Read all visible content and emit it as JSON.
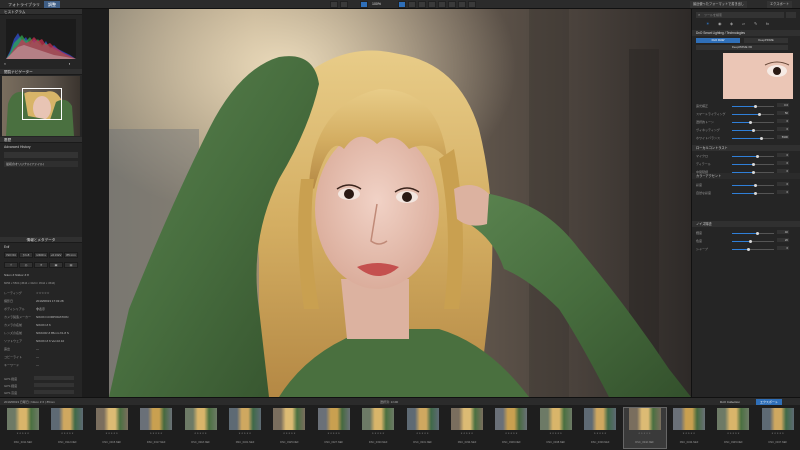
{
  "topbar": {
    "tabs": [
      {
        "label": "フォトライブラリ",
        "active": false
      },
      {
        "label": "調整",
        "active": true
      }
    ],
    "zoom": "100%",
    "right_buttons": [
      "最近使ったフォーマットで書き出し",
      "エクスポート"
    ]
  },
  "left": {
    "histogram_title": "ヒストグラム",
    "navigator_title": "閲覧ナビゲーター",
    "history_title": "履歴",
    "history_item": "Advanced History",
    "history_entry": "最初のオリジナル(ファイル)",
    "info_title": "情報とメタデータ",
    "exif_label": "Exif",
    "exif_values": [
      "ISO 64",
      "ƒ/1.8",
      "1/400 s",
      "+0.3 EV",
      "85 mm"
    ],
    "camera": "Nikon Z Nikkor Z 8",
    "file_dims": "8256 x 5504 (4544 x 3424 / 4544 x 4544)",
    "rows": [
      {
        "label": "レーティング",
        "value": "☆☆☆☆☆"
      },
      {
        "label": "撮影日",
        "value": "2019/08/23 17:03:28"
      },
      {
        "label": "ボディシリアル",
        "value": "非表示"
      },
      {
        "label": "カメラ製造メーカー",
        "value": "NIKON CORPORATION"
      },
      {
        "label": "カメラの名前",
        "value": "NIKON Z 6"
      },
      {
        "label": "レンズの名前",
        "value": "NIKKOR Z 85mm f/1.8 S"
      },
      {
        "label": "ソフトウェア",
        "value": "NIKON Z 6 Ver.02.10"
      },
      {
        "label": "露出",
        "value": "—"
      },
      {
        "label": "コピーライト",
        "value": "—"
      },
      {
        "label": "キーワード",
        "value": "—"
      }
    ],
    "gps_rows": [
      "GPS 緯度",
      "GPS 経度",
      "GPS 高度"
    ]
  },
  "right": {
    "search_placeholder": "ツールを検索",
    "module_title": "DxO Smart Lighting / Technologies",
    "mode_buttons": [
      "DxO RAW",
      "DeepPRIME",
      "DeepPRIME XD"
    ],
    "sliders_a": [
      {
        "label": "露光補正",
        "value": 0.55,
        "num": "0.0"
      },
      {
        "label": "スマートライティング",
        "value": 0.65,
        "num": "50"
      },
      {
        "label": "選択的トーン",
        "value": 0.45,
        "num": "0"
      },
      {
        "label": "ヴィネッティング",
        "value": 0.5,
        "num": "0"
      },
      {
        "label": "ホワイトバランス",
        "value": 0.7,
        "num": "5900"
      }
    ],
    "section_b": "ローカルコントラスト",
    "sliders_b": [
      {
        "label": "マイクロ",
        "value": 0.6,
        "num": "0"
      },
      {
        "label": "ディテール",
        "value": 0.5,
        "num": "0"
      },
      {
        "label": "中間階調",
        "value": 0.5,
        "num": "0"
      }
    ],
    "section_c": "カラーアクセント",
    "sliders_c": [
      {
        "label": "彩度",
        "value": 0.55,
        "num": "0"
      },
      {
        "label": "自然な彩度",
        "value": 0.55,
        "num": "0"
      }
    ],
    "section_d": "ノイズ除去",
    "sliders_d": [
      {
        "label": "輝度",
        "value": 0.6,
        "num": "40"
      },
      {
        "label": "色度",
        "value": 0.45,
        "num": "20"
      },
      {
        "label": "シャープ",
        "value": 0.4,
        "num": "0"
      }
    ]
  },
  "filmstrip": {
    "path": "2019/08/23 日曜日 | Nikon Z 6 | 85mm",
    "status": "選択済: 1/190",
    "right_label": "DxO Collection",
    "export_label": "エクスポート",
    "thumbs": [
      "DSC_0311.NEF",
      "DSC_0312.NEF",
      "DSC_0315.NEF",
      "DSC_0317.NEF",
      "DSC_0318.NEF",
      "DSC_0321.NEF",
      "DSC_0325.NEF",
      "DSC_0327.NEF",
      "DSC_0330.NEF",
      "DSC_0331.NEF",
      "DSC_0334.NEF",
      "DSC_0336.NEF",
      "DSC_0338.NEF",
      "DSC_0339.NEF",
      "DSC_0342.NEF",
      "DSC_0344.NEF",
      "DSC_0345.NEF",
      "DSC_0347.NEF"
    ],
    "selected_index": 14
  },
  "colors": {
    "accent": "#2f7fd8",
    "panel": "#252525",
    "sweater": "#4a7040",
    "hair": "#d9b56a"
  }
}
